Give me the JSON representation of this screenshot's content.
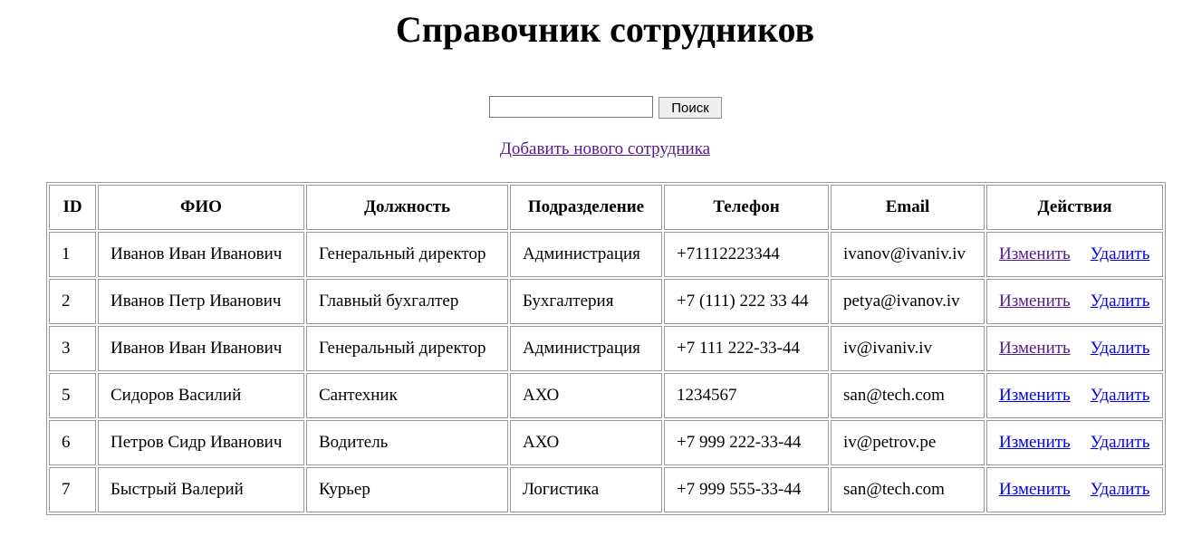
{
  "page": {
    "title": "Справочник сотрудников",
    "search_button_label": "Поиск",
    "search_value": "",
    "add_link_label": "Добавить нового сотрудника"
  },
  "table": {
    "headers": [
      "ID",
      "ФИО",
      "Должность",
      "Подразделение",
      "Телефон",
      "Email",
      "Действия"
    ],
    "rows": [
      {
        "id": "1",
        "name": "Иванов Иван Иванович",
        "position": "Генеральный директор",
        "department": "Администрация",
        "phone": "+71112223344",
        "email": "ivanov@ivaniv.iv",
        "edit": "Изменить",
        "delete": "Удалить",
        "edit_visited": true
      },
      {
        "id": "2",
        "name": "Иванов Петр Иванович",
        "position": "Главный бухгалтер",
        "department": "Бухгалтерия",
        "phone": "+7 (111) 222 33 44",
        "email": "petya@ivanov.iv",
        "edit": "Изменить",
        "delete": "Удалить",
        "edit_visited": true
      },
      {
        "id": "3",
        "name": "Иванов Иван Иванович",
        "position": "Генеральный директор",
        "department": "Администрация",
        "phone": "+7 111 222-33-44",
        "email": "iv@ivaniv.iv",
        "edit": "Изменить",
        "delete": "Удалить",
        "edit_visited": true
      },
      {
        "id": "5",
        "name": "Сидоров Василий",
        "position": "Сантехник",
        "department": "АХО",
        "phone": "1234567",
        "email": "san@tech.com",
        "edit": "Изменить",
        "delete": "Удалить",
        "edit_visited": false
      },
      {
        "id": "6",
        "name": "Петров Сидр Иванович",
        "position": "Водитель",
        "department": "АХО",
        "phone": "+7 999 222-33-44",
        "email": "iv@petrov.pe",
        "edit": "Изменить",
        "delete": "Удалить",
        "edit_visited": false
      },
      {
        "id": "7",
        "name": "Быстрый Валерий",
        "position": "Курьер",
        "department": "Логистика",
        "phone": "+7 999 555-33-44",
        "email": "san@tech.com",
        "edit": "Изменить",
        "delete": "Удалить",
        "edit_visited": false
      }
    ]
  },
  "colors": {
    "link": "#0000ee",
    "visited_link": "#551a8b",
    "border": "#999999"
  }
}
